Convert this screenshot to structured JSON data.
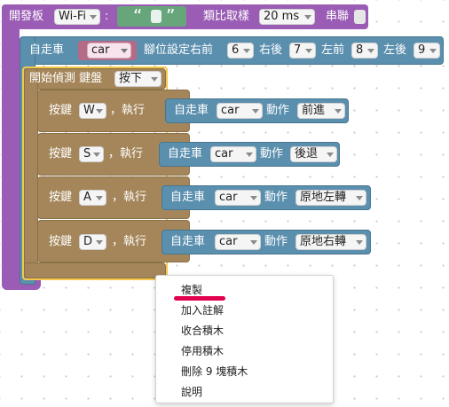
{
  "board_block": {
    "label": "開發板",
    "conn_dropdown": "Wi-Fi",
    "colon": ":",
    "quote_open": "“",
    "quote_close": "”",
    "sampling_label": "類比取樣",
    "sampling_dropdown": "20 ms",
    "serial_label": "串聯"
  },
  "car_block": {
    "label": "自走車",
    "name_dropdown": "car",
    "pin_label": "腳位設定右前",
    "pin_right_front": "6",
    "pin_right_back_label": "右後",
    "pin_right_back": "7",
    "pin_left_front_label": "左前",
    "pin_left_front": "8",
    "pin_left_back_label": "左後",
    "pin_left_back": "9"
  },
  "keyboard_block": {
    "label": "開始偵測 鍵盤",
    "event_dropdown": "按下"
  },
  "key_rows": [
    {
      "key_label": "按鍵",
      "key": "W",
      "then": "，執行",
      "car_label": "自走車",
      "car": "car",
      "action_label": "動作",
      "action": "前進"
    },
    {
      "key_label": "按鍵",
      "key": "S",
      "then": "，執行",
      "car_label": "自走車",
      "car": "car",
      "action_label": "動作",
      "action": "後退"
    },
    {
      "key_label": "按鍵",
      "key": "A",
      "then": "，執行",
      "car_label": "自走車",
      "car": "car",
      "action_label": "動作",
      "action": "原地左轉"
    },
    {
      "key_label": "按鍵",
      "key": "D",
      "then": "，執行",
      "car_label": "自走車",
      "car": "car",
      "action_label": "動作",
      "action": "原地右轉"
    }
  ],
  "context_menu": {
    "items": [
      "複製",
      "加入註解",
      "收合積木",
      "停用積木",
      "刪除 9 塊積木",
      "說明"
    ]
  },
  "colors": {
    "board": "#9a5cb4",
    "car": "#5b8fae",
    "key": "#a5865a",
    "highlight": "#f2c94c",
    "underline": "#e0004d"
  }
}
